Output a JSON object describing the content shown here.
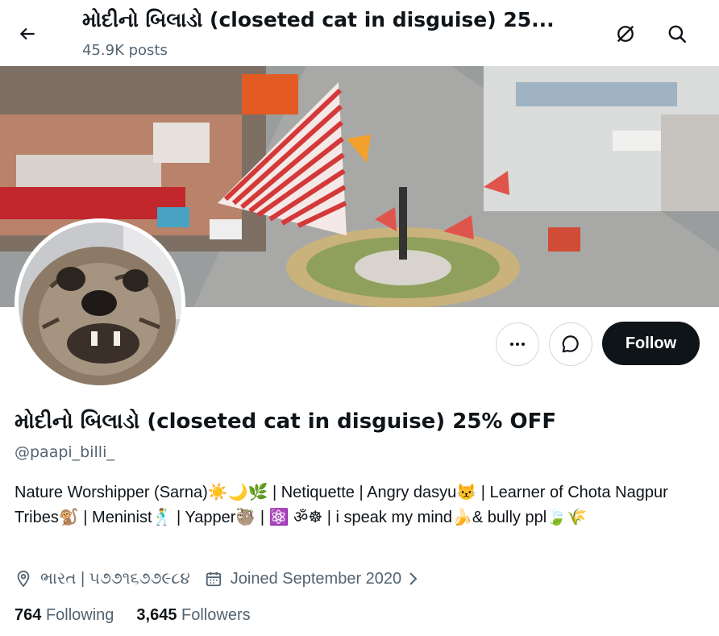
{
  "header": {
    "title": "મોદીનો બિલાડો (closeted cat in disguise) 25...",
    "posts_count": "45.9K posts",
    "back_icon": "arrow-left-icon",
    "grok_icon": "grok-icon",
    "search_icon": "search-icon"
  },
  "profile": {
    "display_name": "મોદીનો બિલાડો (closeted cat in disguise) 25% OFF",
    "handle": "@paapi_billi_",
    "bio": "Nature Worshipper (Sarna)☀️🌙🌿 | Netiquette | Angry dasyu😾 | Learner of Chota Nagpur Tribes🐒 | Meninist🕺 | Yapper🦥 | ⚛️ ॐ☸ | i speak my mind🍌& bully ppl🍃🌾",
    "location": "ભારત | ૫૭૭૧૬૭૭૯૮૪",
    "joined": "Joined September 2020",
    "following_count": "764",
    "following_label": "Following",
    "followers_count": "3,645",
    "followers_label": "Followers"
  },
  "actions": {
    "more_icon": "more-icon",
    "message_icon": "message-icon",
    "follow_label": "Follow"
  },
  "colors": {
    "text": "#0f1419",
    "secondary": "#536471",
    "border": "#cfd9de",
    "follow_bg": "#0f1419"
  }
}
